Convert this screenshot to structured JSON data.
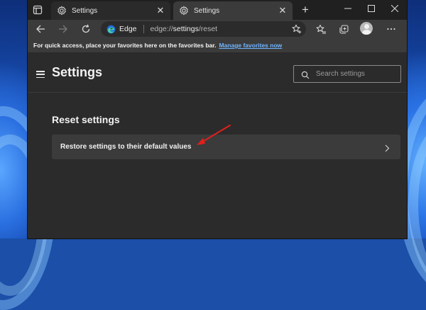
{
  "tabs": [
    {
      "title": "Settings",
      "active": false
    },
    {
      "title": "Settings",
      "active": true
    }
  ],
  "address": {
    "site_label": "Edge",
    "url_prefix": "edge://",
    "url_host": "settings",
    "url_path": "/reset"
  },
  "favorites_bar": {
    "message": "For quick access, place your favorites here on the favorites bar.",
    "link": "Manage favorites now"
  },
  "settings": {
    "title": "Settings",
    "search_placeholder": "Search settings",
    "section_title": "Reset settings",
    "reset_row_label": "Restore settings to their default values"
  },
  "icons": {
    "tab_actions": "tab-actions-icon",
    "tab_favicon": "gear-icon",
    "tab_close": "close-icon",
    "new_tab": "plus-icon",
    "minimize": "minimize-icon",
    "maximize": "maximize-icon",
    "window_close": "close-icon",
    "back": "back-arrow-icon",
    "forward": "forward-arrow-icon",
    "refresh": "refresh-icon",
    "favorites_star": "star-add-icon",
    "favorites": "favorites-icon",
    "collections": "collections-icon",
    "profile": "avatar",
    "more": "more-icon",
    "hamburger": "hamburger-icon",
    "search": "search-icon",
    "chevron": "chevron-right-icon",
    "annotation": "red-arrow-annotation"
  },
  "colors": {
    "link": "#6fb4ff",
    "annotation_arrow": "#e0201c",
    "page_background": "#2b2b2b",
    "row_background": "#3b3b3b"
  }
}
